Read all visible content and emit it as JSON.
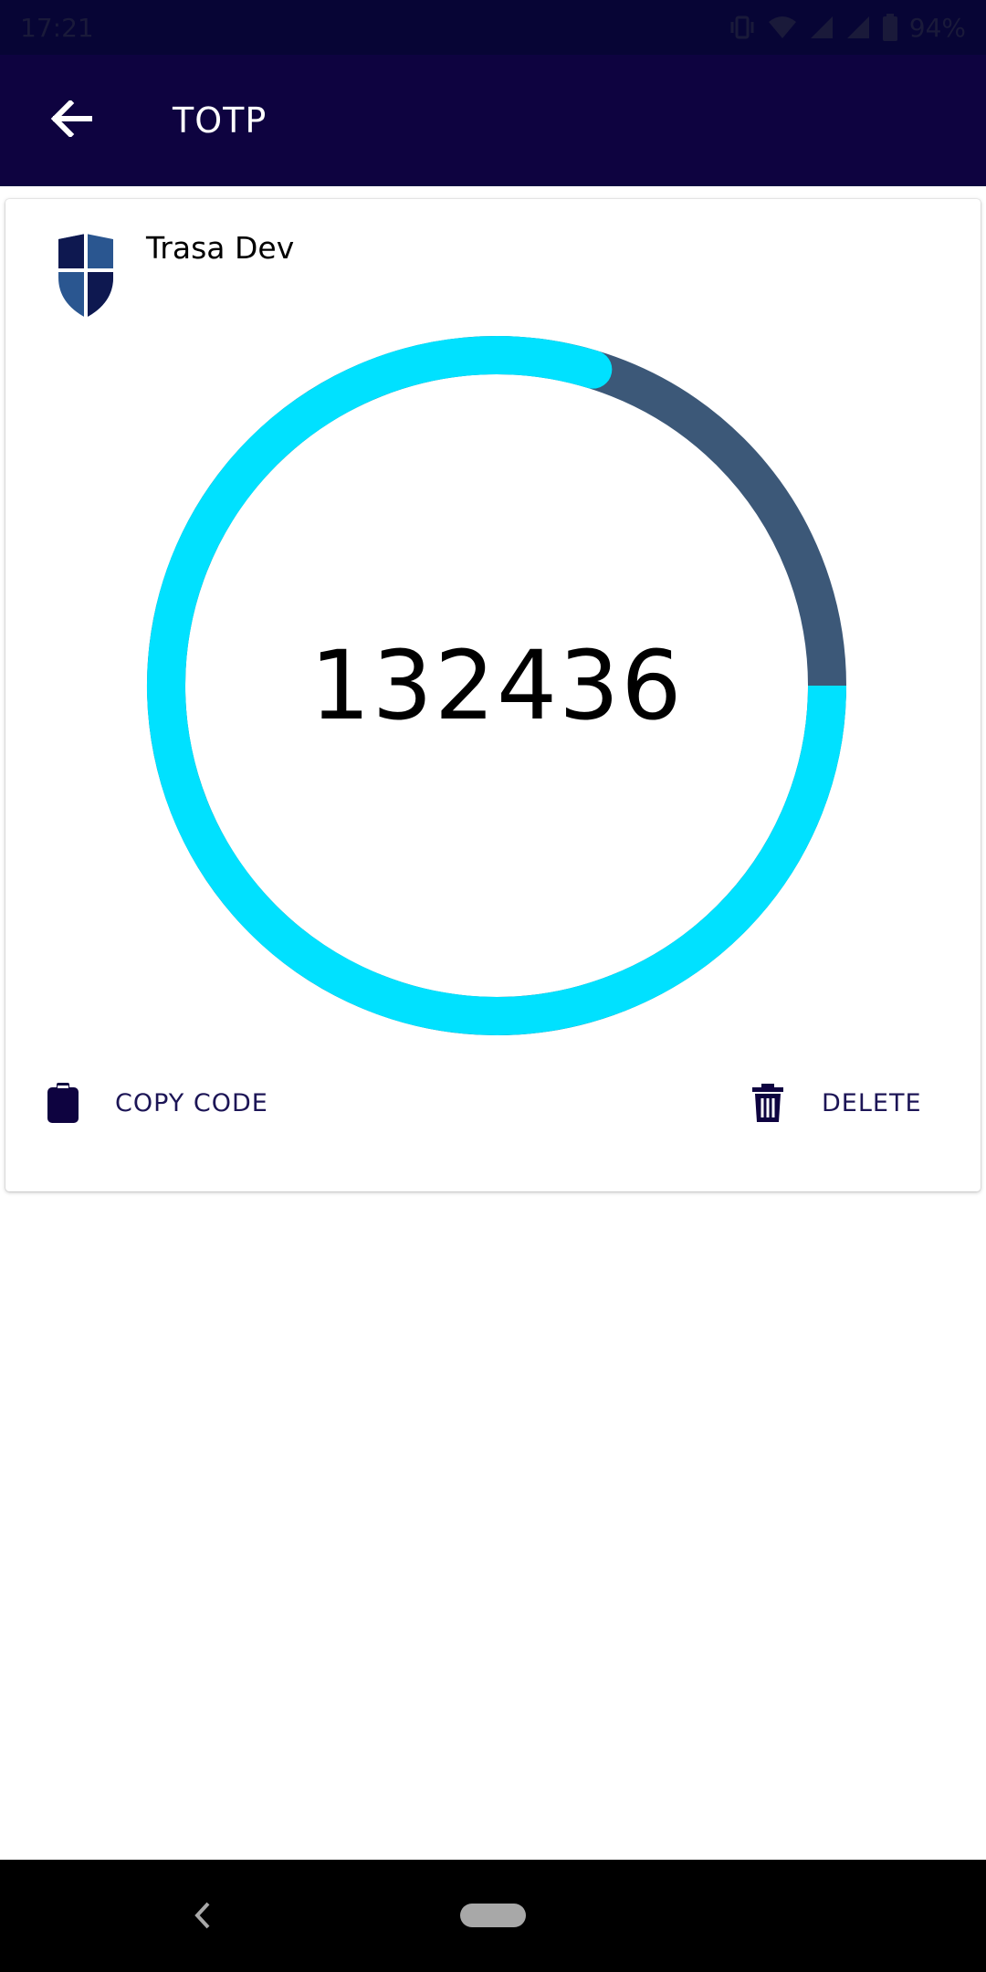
{
  "status_bar": {
    "time": "17:21",
    "battery": "94%",
    "icons": [
      "vibrate-icon",
      "wifi-icon",
      "signal-icon",
      "signal-icon",
      "battery-icon"
    ]
  },
  "app_bar": {
    "title": "TOTP",
    "back_icon": "arrow-left-icon"
  },
  "account": {
    "name": "Trasa Dev",
    "logo_icon": "shield-icon"
  },
  "totp": {
    "code": "132436",
    "remaining_fraction": 0.797,
    "colors": {
      "progress": "#00e1ff",
      "track": "#3c5878"
    }
  },
  "actions": {
    "copy_label": "COPY CODE",
    "copy_icon": "clipboard-icon",
    "delete_label": "DELETE",
    "delete_icon": "trash-icon"
  },
  "colors": {
    "app_bar": "#0e0340",
    "status_bar": "#070535",
    "accent_dark": "#1c1556"
  },
  "nav_bar": {
    "back_icon": "nav-back-icon",
    "home_icon": "nav-home-pill"
  }
}
